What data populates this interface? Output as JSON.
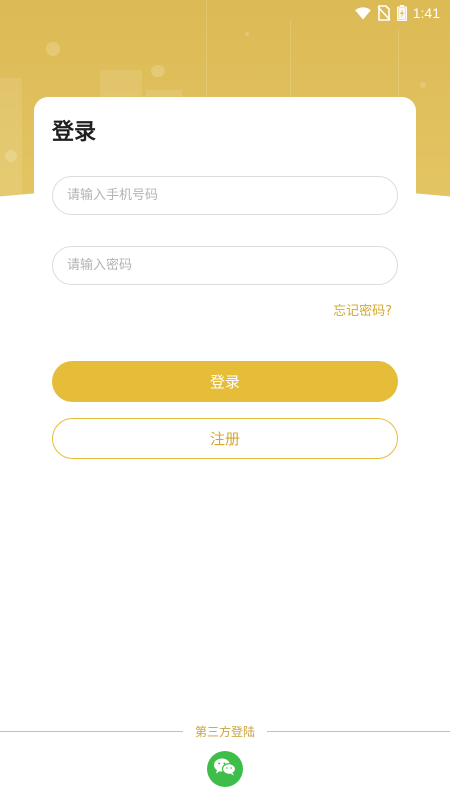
{
  "status_bar": {
    "time": "1:41"
  },
  "login": {
    "title": "登录",
    "phone_placeholder": "请输入手机号码",
    "password_placeholder": "请输入密码",
    "forgot_label": "忘记密码?",
    "login_label": "登录",
    "register_label": "注册"
  },
  "third_party": {
    "label": "第三方登陆",
    "icon": "wechat-icon"
  },
  "colors": {
    "accent": "#e5bd39",
    "accent_text": "#d4a82f",
    "hero_background": "#dcba55",
    "wechat_green": "#3fbd49"
  }
}
